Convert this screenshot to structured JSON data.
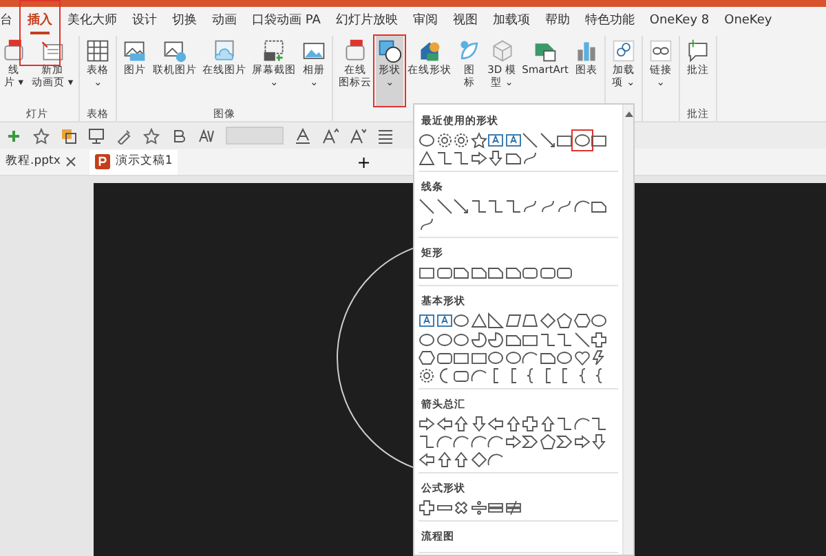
{
  "ribbon_tabs": [
    {
      "label": "台",
      "selected": false,
      "highlighted": false
    },
    {
      "label": "插入",
      "selected": true,
      "highlighted": true
    },
    {
      "label": "美化大师",
      "selected": false,
      "highlighted": false
    },
    {
      "label": "设计",
      "selected": false,
      "highlighted": false
    },
    {
      "label": "切换",
      "selected": false,
      "highlighted": false
    },
    {
      "label": "动画",
      "selected": false,
      "highlighted": false
    },
    {
      "label": "口袋动画 PA",
      "selected": false,
      "highlighted": false
    },
    {
      "label": "幻灯片放映",
      "selected": false,
      "highlighted": false
    },
    {
      "label": "审阅",
      "selected": false,
      "highlighted": false
    },
    {
      "label": "视图",
      "selected": false,
      "highlighted": false
    },
    {
      "label": "加载项",
      "selected": false,
      "highlighted": false
    },
    {
      "label": "帮助",
      "selected": false,
      "highlighted": false
    },
    {
      "label": "特色功能",
      "selected": false,
      "highlighted": false
    },
    {
      "label": "OneKey 8",
      "selected": false,
      "highlighted": false
    },
    {
      "label": "OneKey",
      "selected": false,
      "highlighted": false
    }
  ],
  "ribbon_groups": [
    {
      "label": "灯片",
      "buttons": [
        {
          "kind": "hot",
          "lines": [
            "线",
            "片 ▾"
          ],
          "active": false,
          "highlighted": false
        },
        {
          "kind": "slide",
          "lines": [
            "新加",
            "动画页 ▾"
          ],
          "active": false,
          "highlighted": false
        }
      ]
    },
    {
      "label": "表格",
      "buttons": [
        {
          "kind": "table",
          "lines": [
            "表格",
            "⌄"
          ],
          "active": false,
          "highlighted": false
        }
      ]
    },
    {
      "label": "图像",
      "buttons": [
        {
          "kind": "picture",
          "lines": [
            "图片"
          ],
          "active": false,
          "highlighted": false
        },
        {
          "kind": "online-picture",
          "lines": [
            "联机图片"
          ],
          "active": false,
          "highlighted": false
        },
        {
          "kind": "cloud-picture",
          "lines": [
            "在线图片"
          ],
          "active": false,
          "highlighted": false
        },
        {
          "kind": "screenshot",
          "lines": [
            "屏幕截图",
            "⌄"
          ],
          "active": false,
          "highlighted": false
        },
        {
          "kind": "album",
          "lines": [
            "相册",
            "⌄"
          ],
          "active": false,
          "highlighted": false
        }
      ]
    },
    {
      "buttons": [
        {
          "kind": "hot",
          "lines": [
            "在线",
            "图标云"
          ],
          "active": false,
          "highlighted": false
        },
        {
          "kind": "shapes",
          "lines": [
            "形状",
            "⌄"
          ],
          "active": true,
          "highlighted": true
        },
        {
          "kind": "online-shapes",
          "lines": [
            "在线形状"
          ],
          "active": false,
          "highlighted": false
        },
        {
          "kind": "icons",
          "lines": [
            "图",
            "标"
          ],
          "active": false,
          "highlighted": false
        },
        {
          "kind": "cube",
          "lines": [
            "3D 模",
            "型 ⌄"
          ],
          "active": false,
          "highlighted": false
        },
        {
          "kind": "smartart",
          "lines": [
            "SmartArt"
          ],
          "active": false,
          "highlighted": false
        },
        {
          "kind": "chart",
          "lines": [
            "图表"
          ],
          "active": false,
          "highlighted": false
        }
      ]
    },
    {
      "buttons": [
        {
          "kind": "addin",
          "lines": [
            "加载",
            "项 ⌄"
          ],
          "active": false,
          "highlighted": false
        }
      ]
    },
    {
      "buttons": [
        {
          "kind": "link",
          "lines": [
            "链接",
            "⌄"
          ],
          "active": false,
          "highlighted": false
        }
      ]
    },
    {
      "label": "批注",
      "buttons": [
        {
          "kind": "comment",
          "lines": [
            "批注"
          ],
          "active": false,
          "highlighted": false
        }
      ]
    }
  ],
  "document_tabs": [
    {
      "label": "教程.pptx",
      "selected": false,
      "closable": true
    },
    {
      "label": "演示文稿1",
      "selected": true,
      "closable": false
    }
  ],
  "new_tab_button": "+",
  "shapes_menu": {
    "sections": [
      {
        "title": "最近使用的形状",
        "shapes": [
          {
            "kind": "oval",
            "highlighted": false
          },
          {
            "kind": "gear",
            "highlighted": false
          },
          {
            "kind": "gear",
            "highlighted": false
          },
          {
            "kind": "star",
            "highlighted": false
          },
          {
            "kind": "textbox",
            "highlighted": false
          },
          {
            "kind": "textbox",
            "highlighted": false
          },
          {
            "kind": "line",
            "highlighted": false
          },
          {
            "kind": "arrow-line",
            "highlighted": false
          },
          {
            "kind": "rect",
            "highlighted": false
          },
          {
            "kind": "oval",
            "highlighted": true
          },
          {
            "kind": "rect",
            "highlighted": false
          },
          {
            "kind": "triangle",
            "highlighted": false
          },
          {
            "kind": "elbow",
            "highlighted": false
          },
          {
            "kind": "elbow",
            "highlighted": false
          },
          {
            "kind": "right-arrow",
            "highlighted": false
          },
          {
            "kind": "down-arrow",
            "highlighted": false
          },
          {
            "kind": "snip",
            "highlighted": false
          },
          {
            "kind": "curve",
            "highlighted": false
          }
        ]
      },
      {
        "title": "线条",
        "shapes": [
          {
            "kind": "line",
            "highlighted": false
          },
          {
            "kind": "line",
            "highlighted": false
          },
          {
            "kind": "arrow-line",
            "highlighted": false
          },
          {
            "kind": "elbow",
            "highlighted": false
          },
          {
            "kind": "elbow",
            "highlighted": false
          },
          {
            "kind": "elbow",
            "highlighted": false
          },
          {
            "kind": "curve",
            "highlighted": false
          },
          {
            "kind": "curve",
            "highlighted": false
          },
          {
            "kind": "curve",
            "highlighted": false
          },
          {
            "kind": "arc",
            "highlighted": false
          },
          {
            "kind": "snip",
            "highlighted": false
          },
          {
            "kind": "curve",
            "highlighted": false
          }
        ]
      },
      {
        "title": "矩形",
        "shapes": [
          {
            "kind": "rect",
            "highlighted": false
          },
          {
            "kind": "rounded-rect",
            "highlighted": false
          },
          {
            "kind": "snip",
            "highlighted": false
          },
          {
            "kind": "snip",
            "highlighted": false
          },
          {
            "kind": "snip",
            "highlighted": false
          },
          {
            "kind": "snip",
            "highlighted": false
          },
          {
            "kind": "rounded-rect",
            "highlighted": false
          },
          {
            "kind": "rounded-rect",
            "highlighted": false
          },
          {
            "kind": "rounded-rect",
            "highlighted": false
          }
        ]
      },
      {
        "title": "基本形状",
        "shapes": [
          {
            "kind": "textbox",
            "highlighted": false
          },
          {
            "kind": "textbox",
            "highlighted": false
          },
          {
            "kind": "oval",
            "highlighted": false
          },
          {
            "kind": "triangle",
            "highlighted": false
          },
          {
            "kind": "right-triangle",
            "highlighted": false
          },
          {
            "kind": "parallelogram",
            "highlighted": false
          },
          {
            "kind": "trapezoid",
            "highlighted": false
          },
          {
            "kind": "diamond",
            "highlighted": false
          },
          {
            "kind": "pentagon",
            "highlighted": false
          },
          {
            "kind": "hexagon",
            "highlighted": false
          },
          {
            "kind": "oval",
            "highlighted": false
          },
          {
            "kind": "oval",
            "highlighted": false
          },
          {
            "kind": "oval",
            "highlighted": false
          },
          {
            "kind": "oval",
            "highlighted": false
          },
          {
            "kind": "pie",
            "highlighted": false
          },
          {
            "kind": "pie",
            "highlighted": false
          },
          {
            "kind": "snip",
            "highlighted": false
          },
          {
            "kind": "rect",
            "highlighted": false
          },
          {
            "kind": "elbow",
            "highlighted": false
          },
          {
            "kind": "elbow",
            "highlighted": false
          },
          {
            "kind": "line",
            "highlighted": false
          },
          {
            "kind": "plus",
            "highlighted": false
          },
          {
            "kind": "hexagon",
            "highlighted": false
          },
          {
            "kind": "rounded-rect",
            "highlighted": false
          },
          {
            "kind": "rect",
            "highlighted": false
          },
          {
            "kind": "rect",
            "highlighted": false
          },
          {
            "kind": "oval",
            "highlighted": false
          },
          {
            "kind": "oval",
            "highlighted": false
          },
          {
            "kind": "arc",
            "highlighted": false
          },
          {
            "kind": "snip",
            "highlighted": false
          },
          {
            "kind": "oval",
            "highlighted": false
          },
          {
            "kind": "heart",
            "highlighted": false
          },
          {
            "kind": "bolt",
            "highlighted": false
          },
          {
            "kind": "gear",
            "highlighted": false
          },
          {
            "kind": "moon",
            "highlighted": false
          },
          {
            "kind": "rounded-rect",
            "highlighted": false
          },
          {
            "kind": "arc",
            "highlighted": false
          },
          {
            "kind": "bracket",
            "highlighted": false
          },
          {
            "kind": "bracket",
            "highlighted": false
          },
          {
            "kind": "brace",
            "highlighted": false
          },
          {
            "kind": "bracket",
            "highlighted": false
          },
          {
            "kind": "bracket",
            "highlighted": false
          },
          {
            "kind": "brace",
            "highlighted": false
          },
          {
            "kind": "brace",
            "highlighted": false
          }
        ]
      },
      {
        "title": "箭头总汇",
        "shapes": [
          {
            "kind": "right-arrow",
            "highlighted": false
          },
          {
            "kind": "left-arrow",
            "highlighted": false
          },
          {
            "kind": "up-arrow",
            "highlighted": false
          },
          {
            "kind": "down-arrow",
            "highlighted": false
          },
          {
            "kind": "left-arrow",
            "highlighted": false
          },
          {
            "kind": "up-arrow",
            "highlighted": false
          },
          {
            "kind": "plus",
            "highlighted": false
          },
          {
            "kind": "up-arrow",
            "highlighted": false
          },
          {
            "kind": "elbow",
            "highlighted": false
          },
          {
            "kind": "arc",
            "highlighted": false
          },
          {
            "kind": "elbow",
            "highlighted": false
          },
          {
            "kind": "elbow",
            "highlighted": false
          },
          {
            "kind": "arc",
            "highlighted": false
          },
          {
            "kind": "arc",
            "highlighted": false
          },
          {
            "kind": "arc",
            "highlighted": false
          },
          {
            "kind": "arc",
            "highlighted": false
          },
          {
            "kind": "right-arrow",
            "highlighted": false
          },
          {
            "kind": "chevron",
            "highlighted": false
          },
          {
            "kind": "pentagon",
            "highlighted": false
          },
          {
            "kind": "chevron",
            "highlighted": false
          },
          {
            "kind": "right-arrow",
            "highlighted": false
          },
          {
            "kind": "down-arrow",
            "highlighted": false
          },
          {
            "kind": "left-arrow",
            "highlighted": false
          },
          {
            "kind": "up-arrow",
            "highlighted": false
          },
          {
            "kind": "up-arrow",
            "highlighted": false
          },
          {
            "kind": "diamond",
            "highlighted": false
          },
          {
            "kind": "arc",
            "highlighted": false
          }
        ]
      },
      {
        "title": "公式形状",
        "shapes": [
          {
            "kind": "plus",
            "highlighted": false
          },
          {
            "kind": "minus",
            "highlighted": false
          },
          {
            "kind": "times",
            "highlighted": false
          },
          {
            "kind": "divide",
            "highlighted": false
          },
          {
            "kind": "equal",
            "highlighted": false
          },
          {
            "kind": "not-equal",
            "highlighted": false
          }
        ]
      },
      {
        "title": "流程图"
      }
    ]
  }
}
